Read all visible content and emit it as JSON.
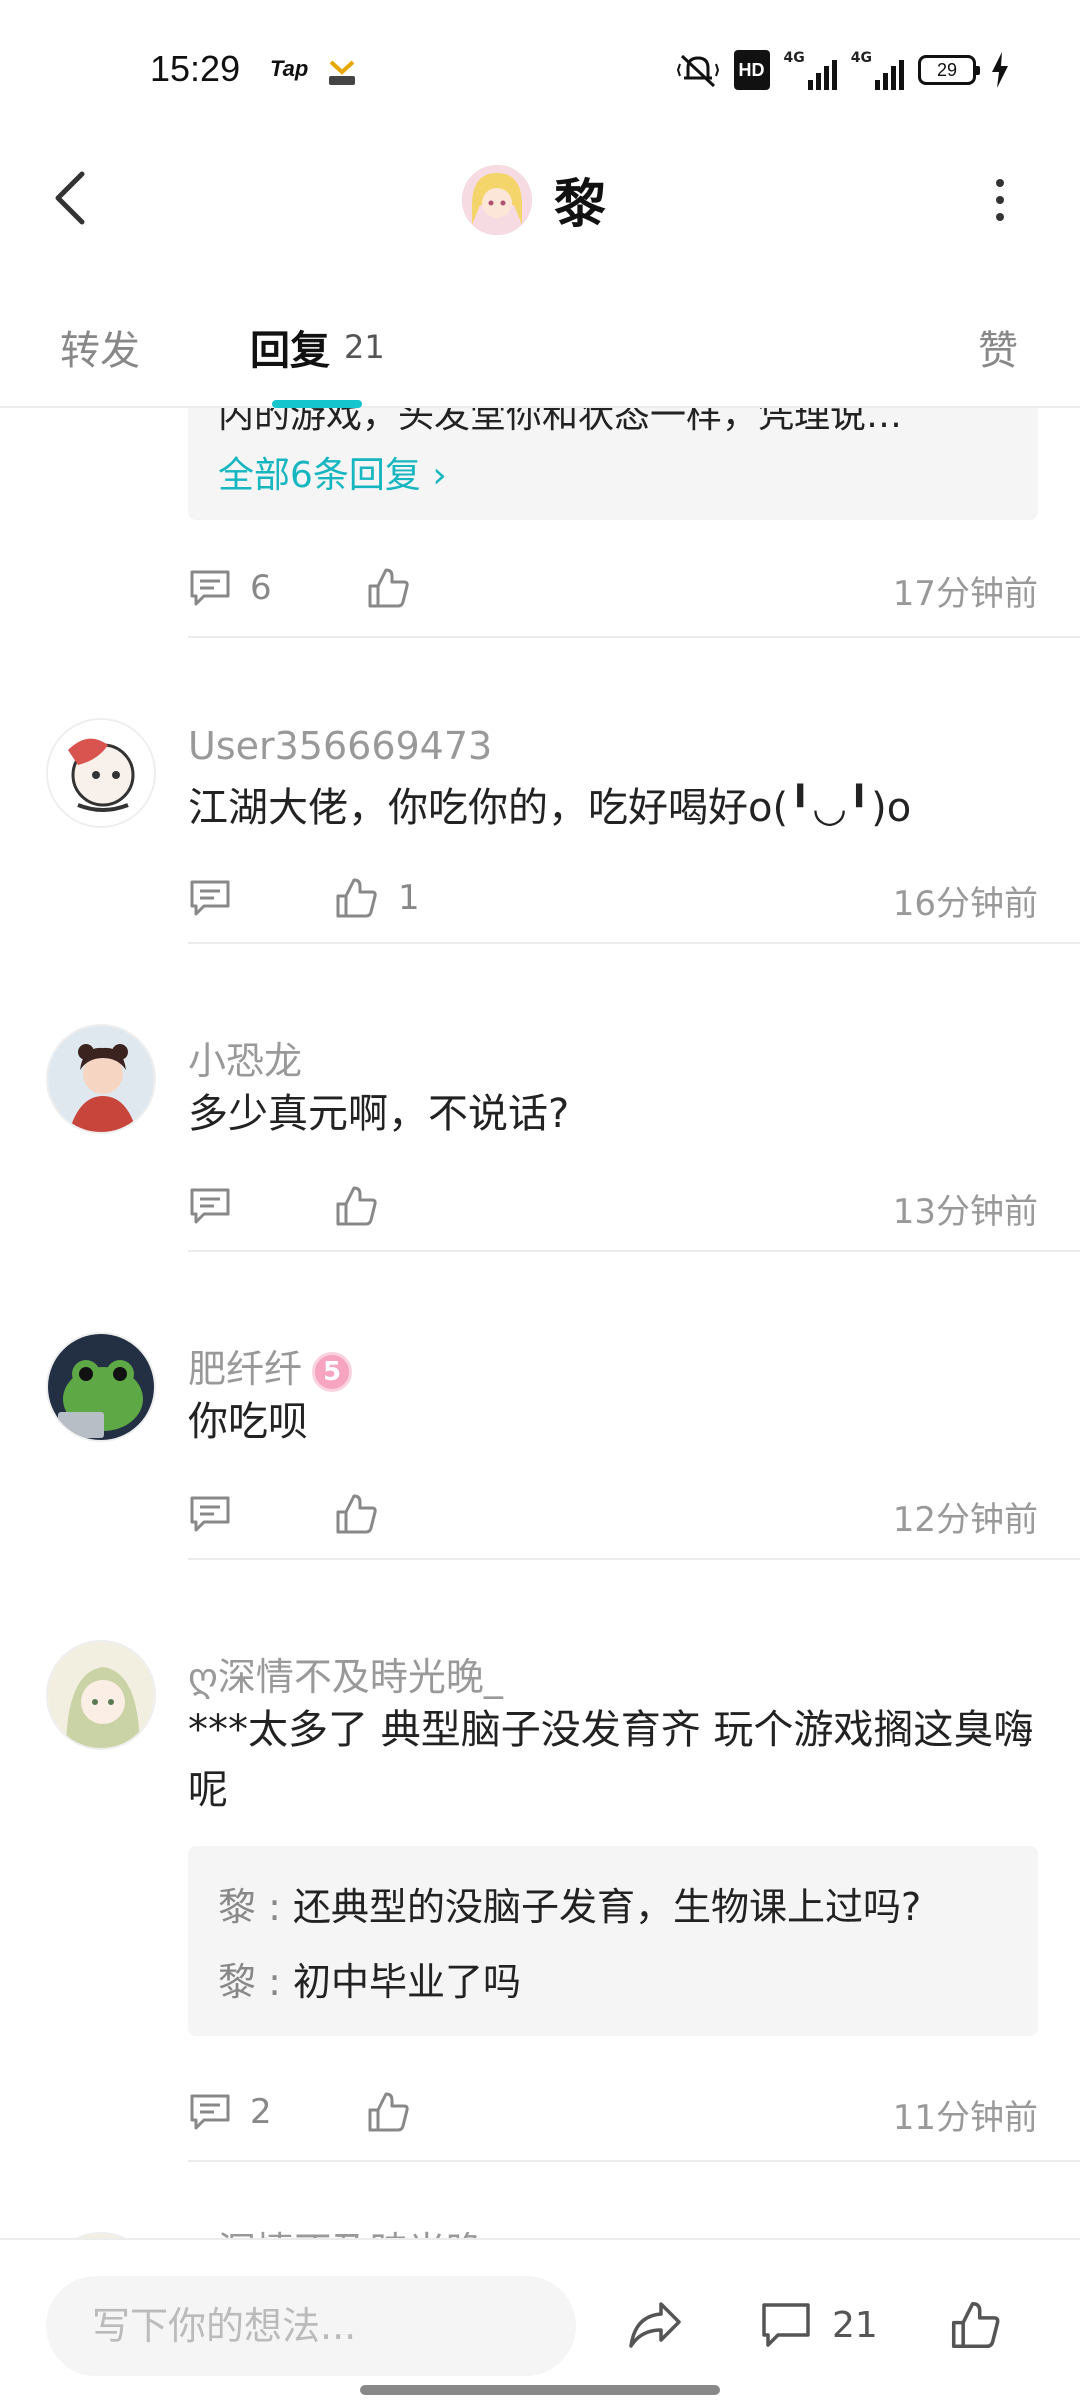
{
  "status_bar": {
    "time": "15:29",
    "app_label": "Tap",
    "network_hd": "HD",
    "network_1": "4G",
    "network_2": "4G",
    "battery": "29"
  },
  "header": {
    "title": "黎",
    "back_icon": "chevron-left-icon",
    "more_icon": "more-vertical-icon"
  },
  "tabs": {
    "repost": "转发",
    "reply": "回复",
    "reply_count": "21",
    "like": "赞",
    "accent_color": "#15c5ce"
  },
  "first_comment": {
    "partial_text": "内的游戏，头发堂你和状态一样，凭理说…",
    "all_replies_link": "全部6条回复 ›",
    "reply_count": "6",
    "timestamp": "17分钟前"
  },
  "comments": [
    {
      "username": "User356669473",
      "text": "江湖大佬，你吃你的，吃好喝好o(╹◡╹)o",
      "like_count": "1",
      "timestamp": "16分钟前"
    },
    {
      "username": "小恐龙",
      "text": "多少真元啊，不说话?",
      "timestamp": "13分钟前"
    },
    {
      "username": "肥纤纤",
      "level_badge": "5",
      "text": "你吃呗",
      "timestamp": "12分钟前"
    },
    {
      "username": "ღ深情不及時光晚_",
      "text": "***太多了 典型脑子没发育齐 玩个游戏搁这臭嗨呢",
      "replies": [
        {
          "author": "黎",
          "sep": " : ",
          "text": "还典型的没脑子发育，生物课上过吗?"
        },
        {
          "author": "黎",
          "sep": " : ",
          "text": "初中毕业了吗"
        }
      ],
      "reply_count": "2",
      "timestamp": "11分钟前"
    },
    {
      "username": "ღ深情不及時光晚_"
    }
  ],
  "bottom_bar": {
    "input_placeholder": "写下你的想法...",
    "comment_count": "21"
  }
}
